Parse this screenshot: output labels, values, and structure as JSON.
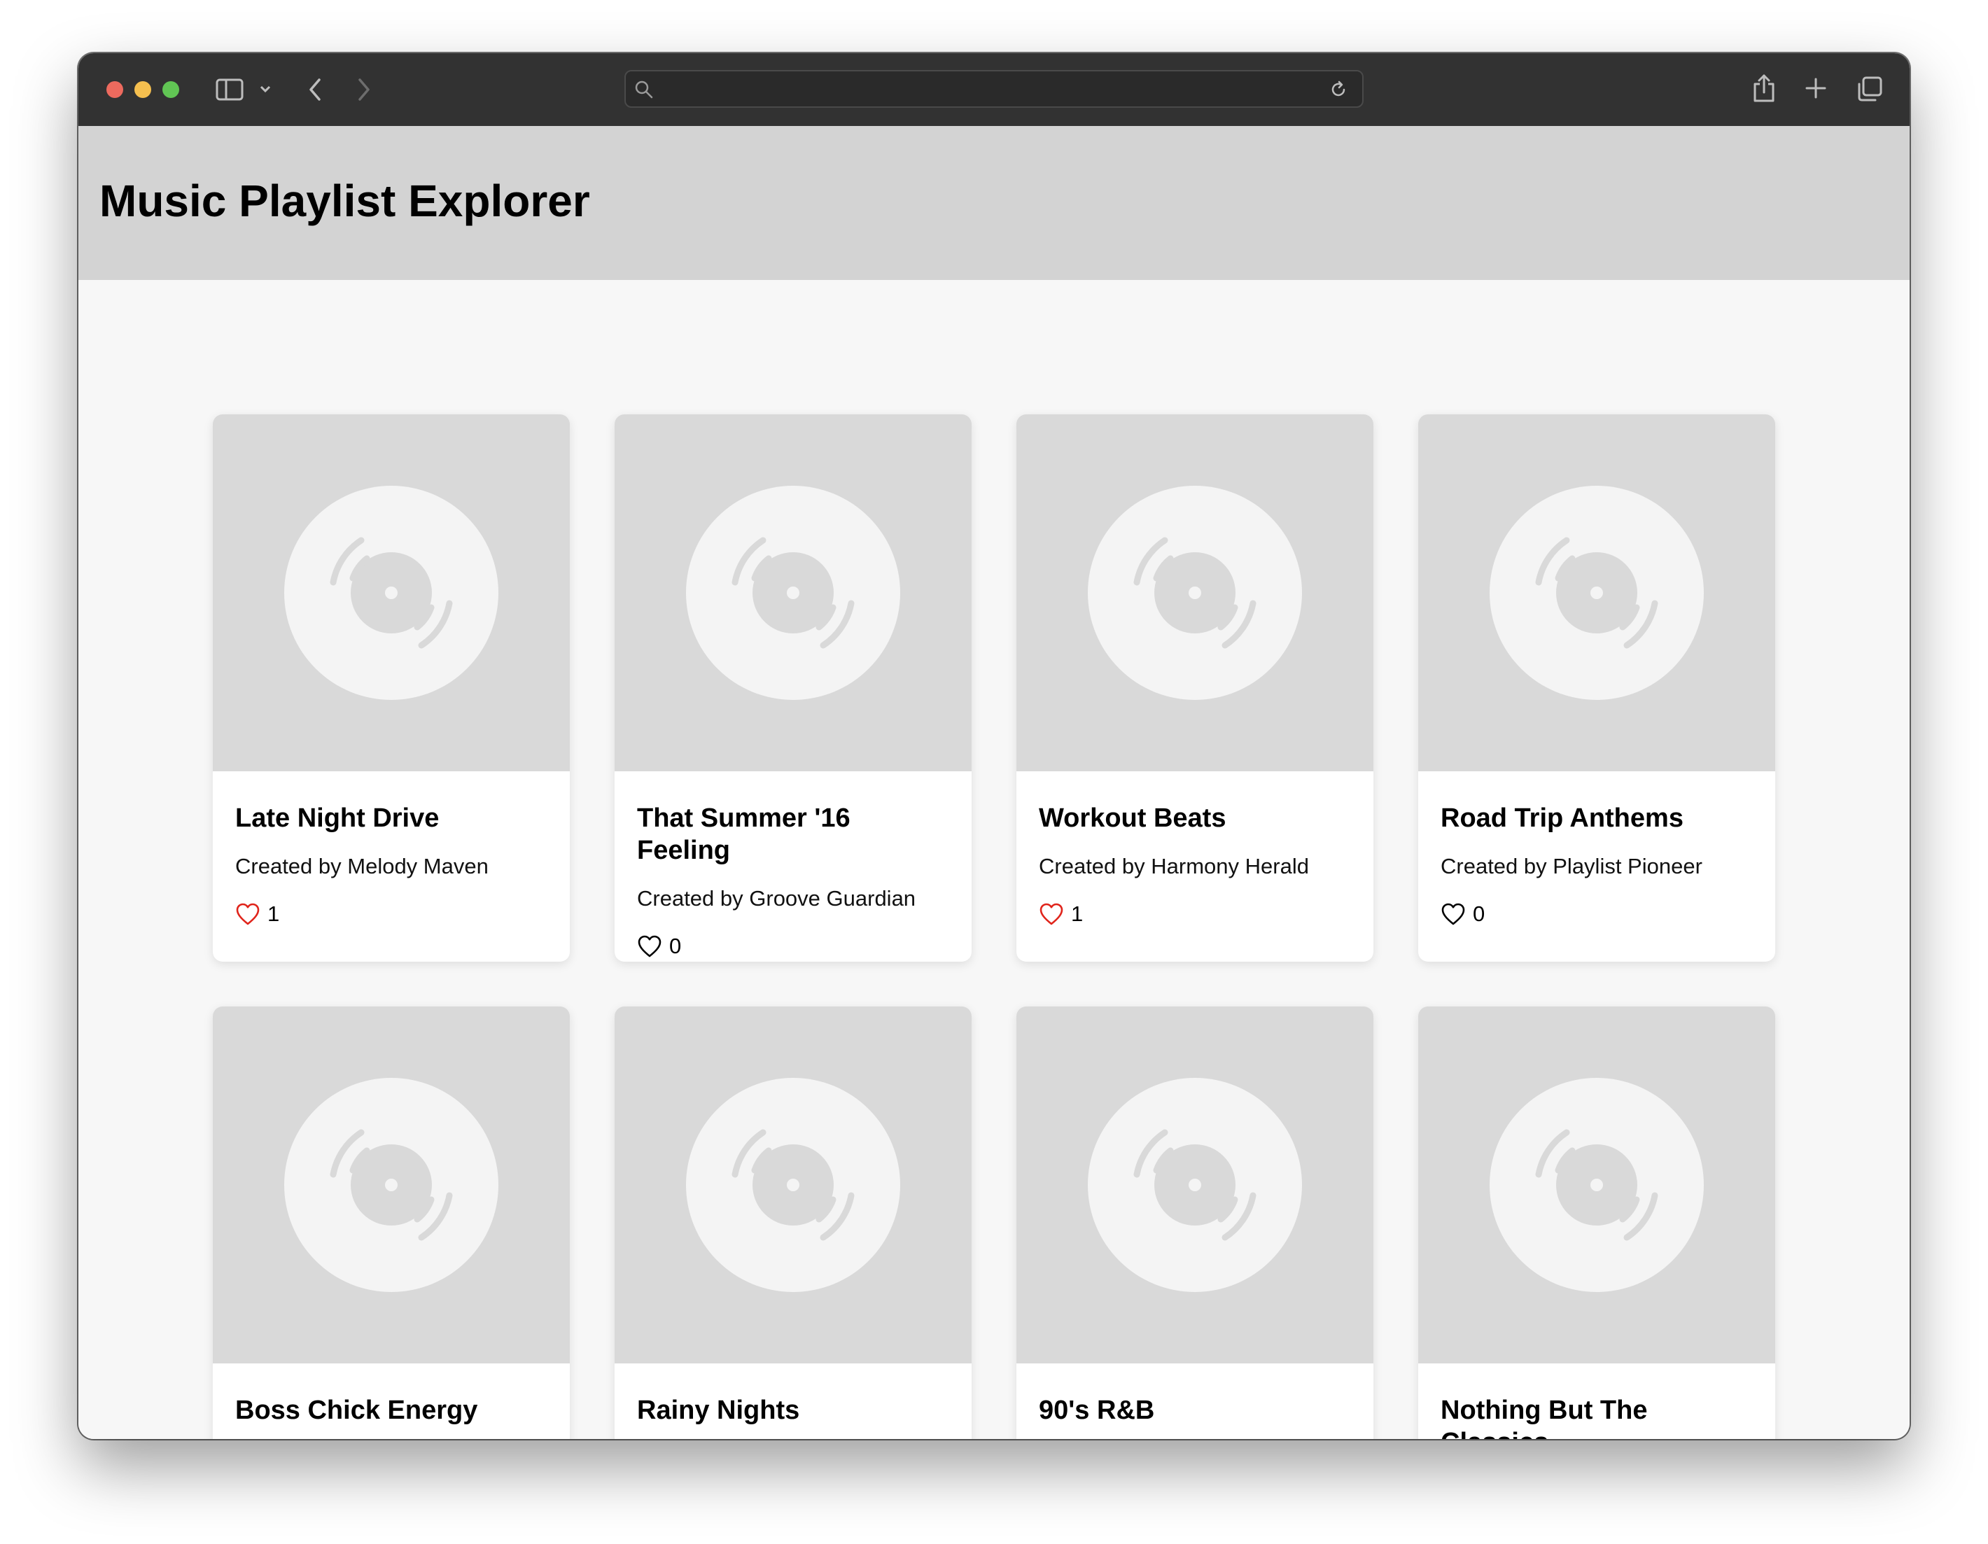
{
  "browser": {
    "address_value": "",
    "address_placeholder": ""
  },
  "header": {
    "title": "Music Playlist Explorer"
  },
  "colors": {
    "liked_heart": "#e0241b",
    "unliked_heart": "#000000",
    "header_bg": "#d3d3d3"
  },
  "playlists": [
    {
      "title": "Late Night Drive",
      "creator": "Created by Melody Maven",
      "likes": "1",
      "liked": true
    },
    {
      "title": "That Summer '16 Feeling",
      "creator": "Created by Groove Guardian",
      "likes": "0",
      "liked": false
    },
    {
      "title": "Workout Beats",
      "creator": "Created by Harmony Herald",
      "likes": "1",
      "liked": true
    },
    {
      "title": "Road Trip Anthems",
      "creator": "Created by Playlist Pioneer",
      "likes": "0",
      "liked": false
    },
    {
      "title": "Boss Chick Energy",
      "creator": "",
      "likes": "",
      "liked": false
    },
    {
      "title": "Rainy Nights",
      "creator": "",
      "likes": "",
      "liked": false
    },
    {
      "title": "90's R&B",
      "creator": "",
      "likes": "",
      "liked": false
    },
    {
      "title": "Nothing But The Classics",
      "creator": "",
      "likes": "",
      "liked": false
    }
  ]
}
